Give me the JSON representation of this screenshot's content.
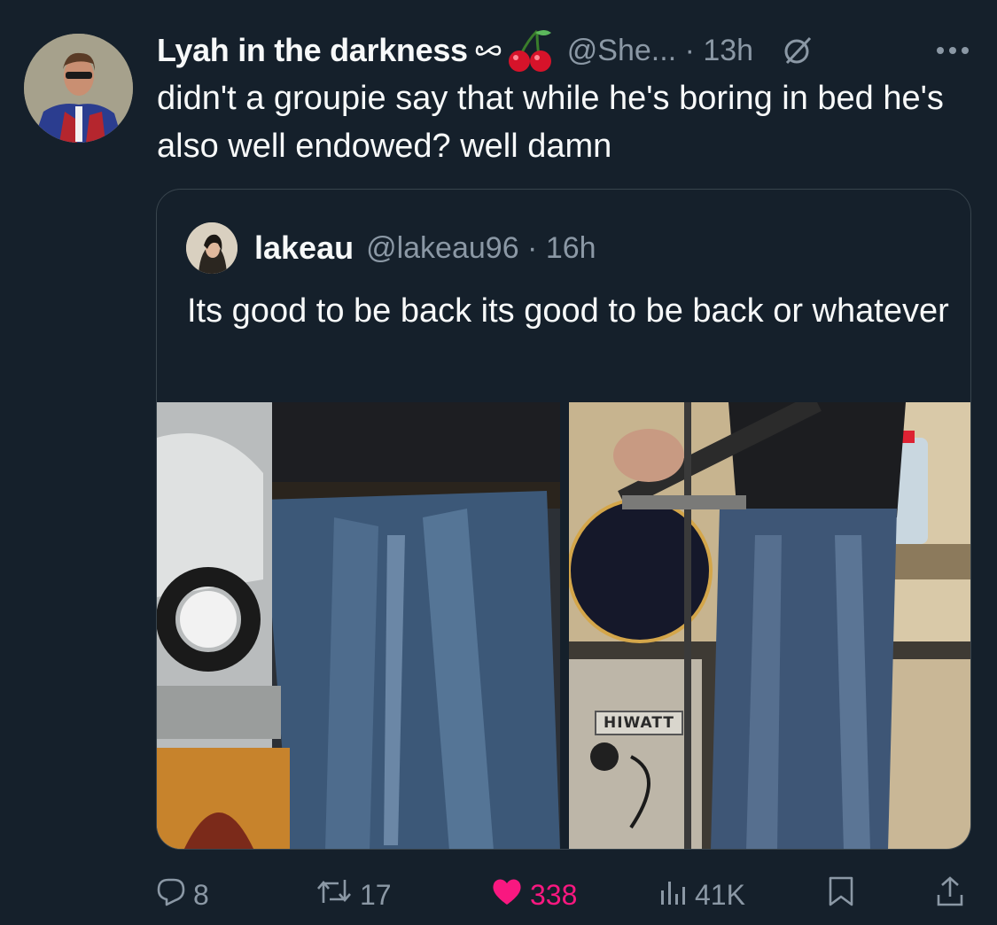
{
  "tweet": {
    "display_name": "Lyah in the darkness",
    "name_emoji": "🍒",
    "handle_time": "@She... · 13h",
    "text": "didn't a groupie say that while he's boring in bed he's also well endowed? well damn"
  },
  "quoted": {
    "display_name": "lakeau",
    "handle_time": "@lakeau96 · 16h",
    "text": "Its good to be back its good to be back or whatever",
    "amp_label": "HIWATT"
  },
  "actions": {
    "replies": "8",
    "retweets": "17",
    "likes": "338",
    "views": "41K"
  },
  "colors": {
    "background": "#15202b",
    "text": "#f7f9f9",
    "secondary": "#8b98a5",
    "like": "#f91880",
    "border": "#38444d"
  },
  "icons": [
    "infinity-icon",
    "cherry-icon",
    "grok-icon",
    "more-icon",
    "reply-icon",
    "retweet-icon",
    "like-icon",
    "views-icon",
    "bookmark-icon",
    "share-icon"
  ]
}
